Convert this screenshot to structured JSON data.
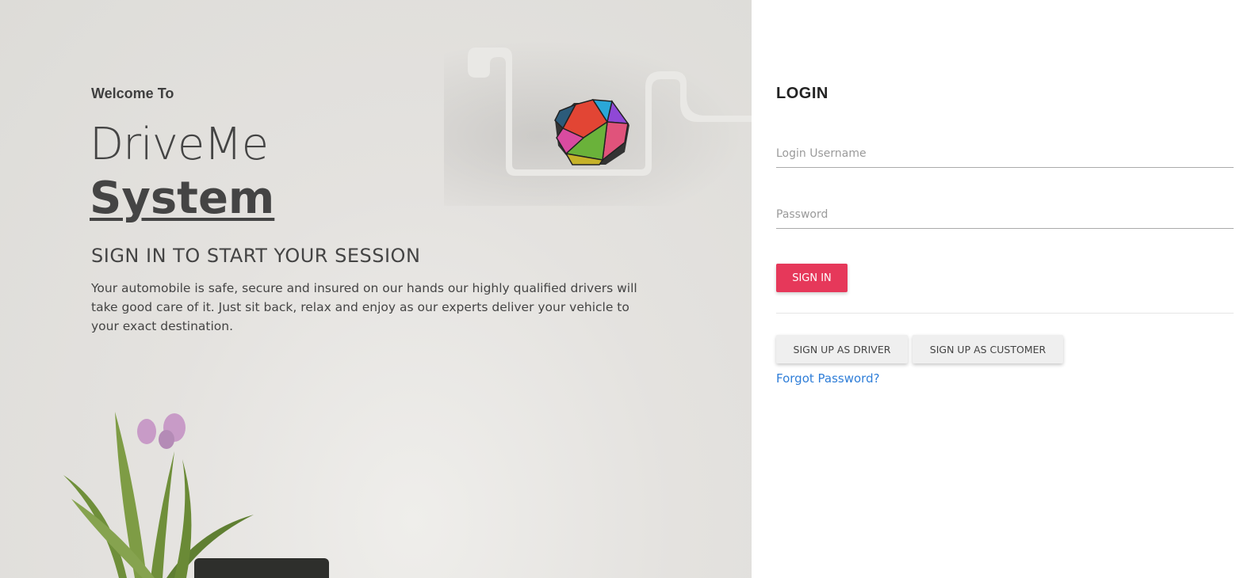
{
  "hero": {
    "welcome": "Welcome To",
    "brand": "DriveMe",
    "system": "System",
    "tagline": "SIGN IN TO START YOUR SESSION",
    "description": "Your automobile is safe, secure and insured on our hands our highly qualified drivers will take good care of it. Just sit back, relax and enjoy as our experts deliver your vehicle to your exact destination."
  },
  "login": {
    "title": "LOGIN",
    "username_placeholder": "Login Username",
    "username_value": "",
    "password_placeholder": "Password",
    "password_value": "",
    "signin_label": "SIGN IN",
    "signup_driver_label": "SIGN UP AS DRIVER",
    "signup_customer_label": "SIGN UP AS CUSTOMER",
    "forgot_label": "Forgot Password?"
  },
  "colors": {
    "primary": "#e6385a",
    "link": "#2f7ed8",
    "hero_bg": "#e2e0dc"
  },
  "icons": [
    "geometric-ball-icon",
    "flower-plant-icon"
  ]
}
